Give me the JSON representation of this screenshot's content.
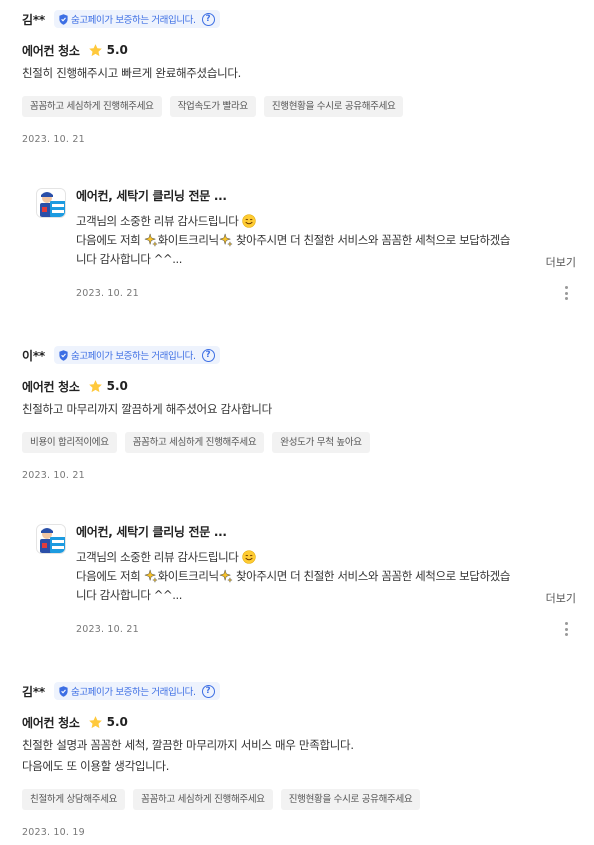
{
  "guarantee_text": "숨고페이가 보증하는 거래입니다.",
  "more_label": "더보기",
  "reviews": [
    {
      "author": "김**",
      "service": "에어컨 청소",
      "rating": "5.0",
      "lines": [
        "친절히 진행해주시고 빠르게 완료해주셨습니다."
      ],
      "tags": [
        "꼼꼼하고 세심하게 진행해주세요",
        "작업속도가 빨라요",
        "진행현황을 수시로 공유해주세요"
      ],
      "date": "2023. 10. 21"
    },
    {
      "author": "이**",
      "service": "에어컨 청소",
      "rating": "5.0",
      "lines": [
        "친절하고 마무리까지 깔끔하게 해주셨어요 감사합니다"
      ],
      "tags": [
        "비용이 합리적이에요",
        "꼼꼼하고 세심하게 진행해주세요",
        "완성도가 무척 높아요"
      ],
      "date": "2023. 10. 21"
    },
    {
      "author": "김**",
      "service": "에어컨 청소",
      "rating": "5.0",
      "lines": [
        "친절한 설명과 꼼꼼한 세척, 깔끔한 마무리까지 서비스 매우 만족합니다.",
        "다음에도 또 이용할 생각입니다."
      ],
      "tags": [
        "친절하게 상담해주세요",
        "꼼꼼하고 세심하게 진행해주세요",
        "진행현황을 수시로 공유해주세요"
      ],
      "date": "2023. 10. 19"
    }
  ],
  "replies": [
    {
      "business": "에어컨, 세탁기 클리닝 전문 ...",
      "line1": "고객님의 소중한 리뷰 감사드립니다",
      "line2a": "다음에도 저희",
      "line2b": "화이트크리닉",
      "line2c": "찾아주시면 더 친절한 서비스와 꼼꼼한 세척으로 보답하겠습",
      "line3": "니다 감사합니다 ^^...",
      "date": "2023. 10. 21"
    },
    {
      "business": "에어컨, 세탁기 클리닝 전문 ...",
      "line1": "고객님의 소중한 리뷰 감사드립니다",
      "line2a": "다음에도 저희",
      "line2b": "화이트크리닉",
      "line2c": "찾아주시면 더 친절한 서비스와 꼼꼼한 세척으로 보답하겠습",
      "line3": "니다 감사합니다 ^^...",
      "date": "2023. 10. 21"
    }
  ],
  "colors": {
    "accent": "#3d6fe4",
    "tag_bg": "#f2f2f2",
    "star": "#ffc93c"
  }
}
